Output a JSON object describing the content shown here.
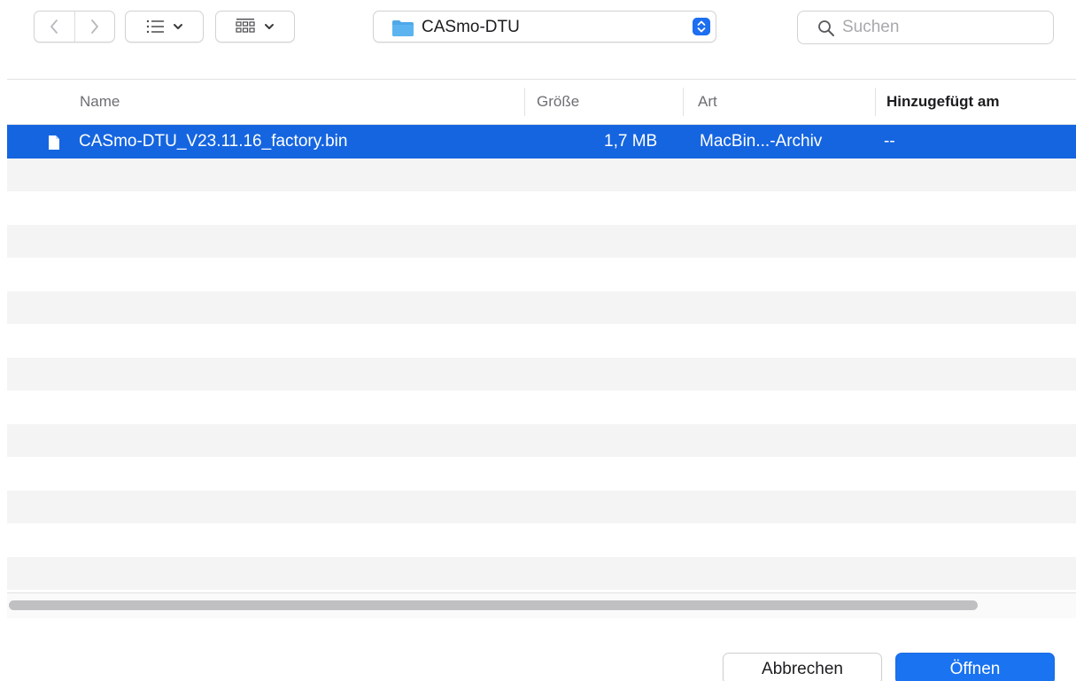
{
  "toolbar": {
    "back_icon": "chevron-left-icon",
    "forward_icon": "chevron-right-icon",
    "view_mode_icon": "list-view-icon",
    "group_icon": "grid-view-icon",
    "path_popup": {
      "folder_icon": "folder-icon",
      "label": "CASmo-DTU",
      "stepper_icon": "up-down-stepper-icon"
    },
    "search": {
      "icon": "search-icon",
      "placeholder": "Suchen",
      "value": ""
    }
  },
  "file_list": {
    "columns": [
      {
        "label": "Name"
      },
      {
        "label": "Größe"
      },
      {
        "label": "Art"
      },
      {
        "label": "Hinzugefügt am",
        "sorted": true
      }
    ],
    "rows": [
      {
        "icon": "document-icon",
        "name": "CASmo-DTU_V23.11.16_factory.bin",
        "size": "1,7 MB",
        "kind": "MacBin...-Archiv",
        "added": "--",
        "selected": true
      }
    ]
  },
  "footer": {
    "cancel_label": "Abbrechen",
    "open_label": "Öffnen"
  },
  "colors": {
    "accent": "#1565e0",
    "open_button": "#1a73f0",
    "stripe": "#f4f4f5",
    "folder": "#4fa8e8"
  }
}
